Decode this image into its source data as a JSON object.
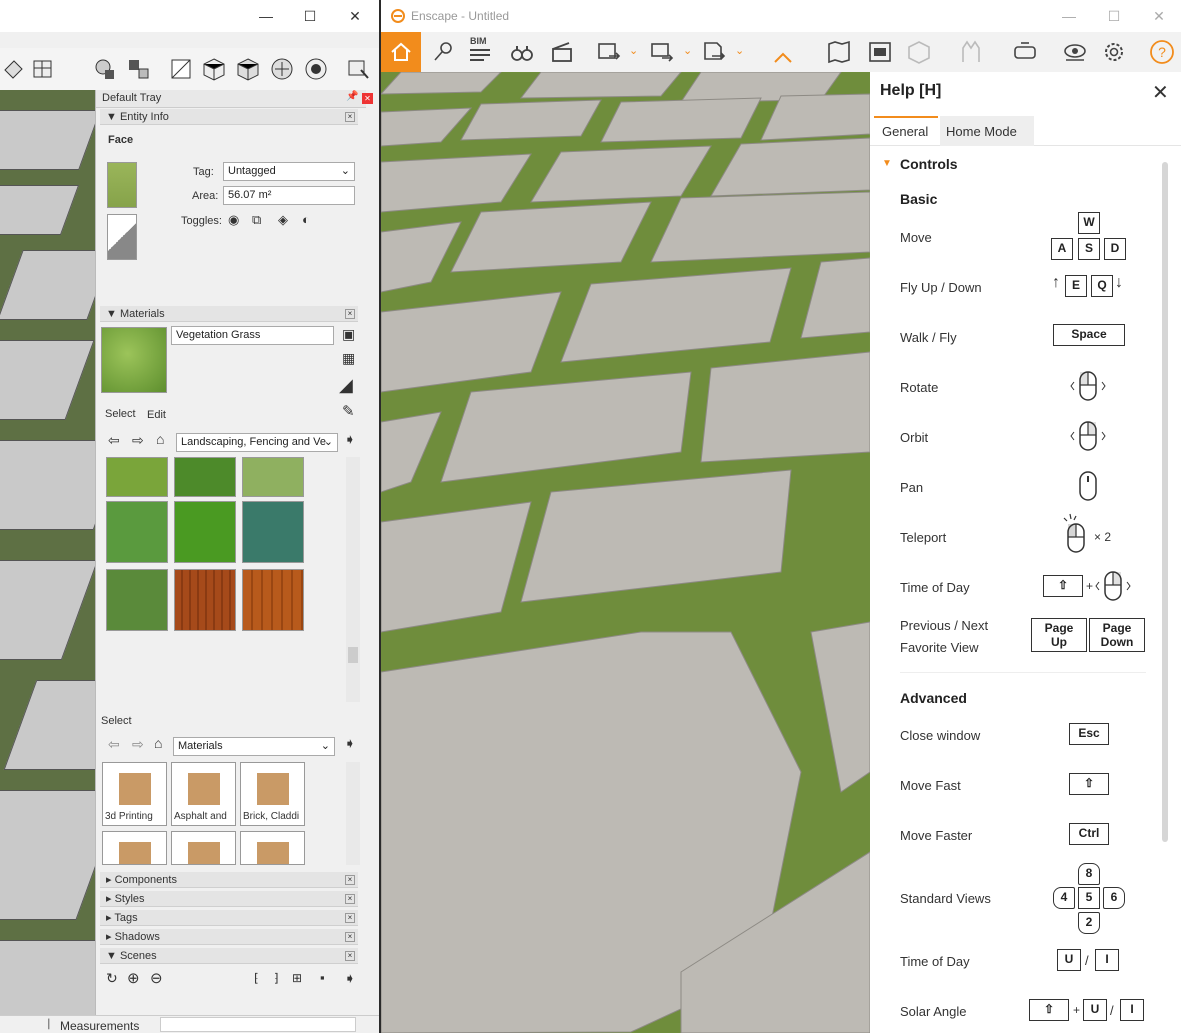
{
  "sketchup": {
    "window_controls": {
      "min": "—",
      "max": "☐",
      "close": "✕"
    },
    "tray": {
      "title": "Default Tray",
      "entity_info": {
        "header": "Entity Info",
        "type": "Face",
        "tag_label": "Tag:",
        "tag_value": "Untagged",
        "area_label": "Area:",
        "area_value": "56.07 m²",
        "toggles_label": "Toggles:"
      },
      "materials": {
        "header": "Materials",
        "name": "Vegetation Grass",
        "tabs": [
          "Select",
          "Edit"
        ],
        "collection": "Landscaping, Fencing and Ve"
      },
      "select2": {
        "label": "Select",
        "collection": "Materials",
        "folders": [
          "3d Printing",
          "Asphalt and",
          "Brick, Claddi"
        ]
      },
      "sections": [
        "Components",
        "Styles",
        "Tags",
        "Shadows",
        "Scenes"
      ]
    },
    "status": {
      "measurements": "Measurements"
    }
  },
  "enscape": {
    "title": "Enscape - Untitled",
    "toolbar": {
      "bim_label": "BIM"
    },
    "colors": {
      "accent": "#f28c1c"
    },
    "help": {
      "title": "Help [H]",
      "tabs": [
        "General",
        "Home Mode"
      ],
      "section": "Controls",
      "basic": "Basic",
      "rows": {
        "move": "Move",
        "fly": "Fly Up / Down",
        "walk": "Walk / Fly",
        "rotate": "Rotate",
        "orbit": "Orbit",
        "pan": "Pan",
        "teleport": "Teleport",
        "time": "Time of Day",
        "prev1": "Previous / Next",
        "prev2": "Favorite View"
      },
      "advanced": "Advanced",
      "adv_rows": {
        "close": "Close window",
        "fast": "Move Fast",
        "faster": "Move Faster",
        "views": "Standard Views",
        "time": "Time of Day",
        "solar": "Solar Angle"
      },
      "keys": {
        "w": "W",
        "a": "A",
        "s": "S",
        "d": "D",
        "e": "E",
        "q": "Q",
        "space": "Space",
        "times2": "× 2",
        "pgup1": "Page",
        "pgup2": "Up",
        "pgdn1": "Page",
        "pgdn2": "Down",
        "esc": "Esc",
        "ctrl": "Ctrl",
        "n8": "8",
        "n4": "4",
        "n5": "5",
        "n6": "6",
        "n2": "2",
        "u": "U",
        "i": "I",
        "slash": "/",
        "plus": "+"
      }
    }
  }
}
